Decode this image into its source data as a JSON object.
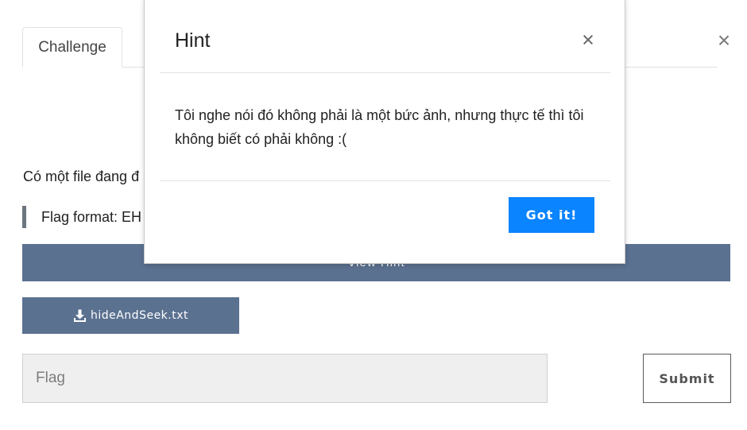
{
  "challenge": {
    "tab_label": "Challenge",
    "close_glyph": "×",
    "description": "Có một file đang đ",
    "flag_format": "Flag format: EH",
    "view_hint_label": "View Hint",
    "file_button_label": "hideAndSeek.txt",
    "file_icon": "download-icon",
    "flag_placeholder": "Flag",
    "flag_value": "",
    "submit_label": "Submit"
  },
  "hint_modal": {
    "title": "Hint",
    "close_glyph": "×",
    "body": "Tôi nghe nói đó không phải là một bức ảnh, nhưng thực tế thì tôi không biết có phải không :(",
    "confirm_label": "Got it!"
  },
  "colors": {
    "primary_button": "#5b7190",
    "confirm_button": "#0a84ff",
    "quote_border": "#6c757d"
  }
}
